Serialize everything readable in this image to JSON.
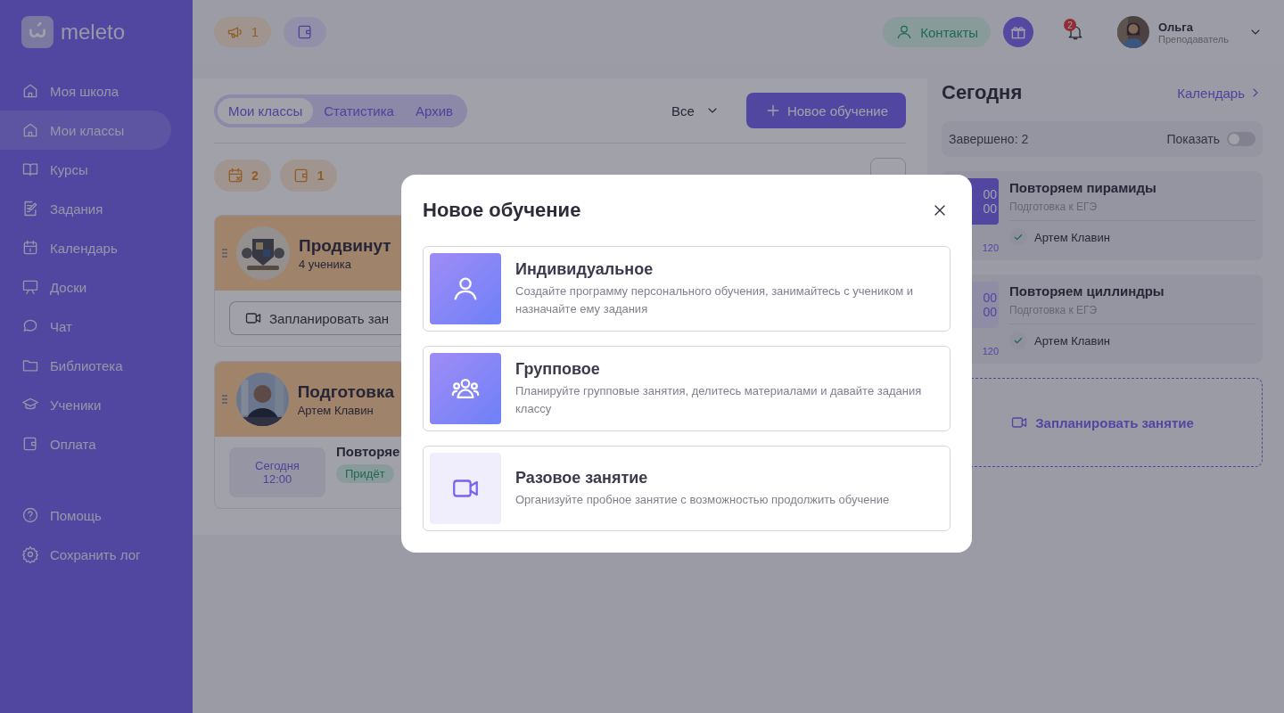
{
  "sidebar": {
    "logo": "meleto",
    "items": [
      {
        "label": "Моя школа",
        "selected": false
      },
      {
        "label": "Мои классы",
        "selected": true
      },
      {
        "label": "Курсы",
        "selected": false
      },
      {
        "label": "Задания",
        "selected": false
      },
      {
        "label": "Календарь",
        "selected": false
      },
      {
        "label": "Доски",
        "selected": false
      },
      {
        "label": "Чат",
        "selected": false
      },
      {
        "label": "Библиотека",
        "selected": false
      },
      {
        "label": "Ученики",
        "selected": false
      },
      {
        "label": "Оплата",
        "selected": false
      }
    ],
    "bottom_items": [
      {
        "label": "Помощь",
        "selected": false
      },
      {
        "label": "Сохранить лог",
        "selected": false
      }
    ]
  },
  "topbar": {
    "announcements": "1",
    "contacts": "Контакты",
    "notifications": "2",
    "user": {
      "name": "Ольга",
      "role": "Преподаватель"
    }
  },
  "classes": {
    "tabs": [
      {
        "label": "Мои классы",
        "selected": true
      },
      {
        "label": "Статистика",
        "selected": false
      },
      {
        "label": "Архив",
        "selected": false
      }
    ],
    "filter": "Все",
    "new_button": "Новое обучение",
    "badges": [
      {
        "kind": "calendar",
        "count": "2"
      },
      {
        "kind": "wallet",
        "count": "1"
      }
    ],
    "cards": [
      {
        "kind": "group",
        "title": "Продвинут",
        "subtitle": "4 ученика",
        "action": "Запланировать зан"
      },
      {
        "kind": "individual",
        "title": "Подготовка",
        "subtitle": "Артем Клавин",
        "lesson": {
          "day": "Сегодня",
          "time": "12:00",
          "title": "Повторяе",
          "status": "Придёт"
        }
      }
    ]
  },
  "today": {
    "title": "Сегодня",
    "calendar_link": "Календарь",
    "completed": "Завершено: 2",
    "show_label": "Показать",
    "show_on": false,
    "lessons": [
      {
        "start": "00",
        "end": "00",
        "count": "120",
        "highlighted": true,
        "title": "Повторяем пирамиды",
        "course": "Подготовка к ЕГЭ",
        "student": "Артем Клавин",
        "confirmed": true
      },
      {
        "start": "00",
        "end": "00",
        "count": "120",
        "highlighted": false,
        "title": "Повторяем циллиндры",
        "course": "Подготовка к ЕГЭ",
        "student": "Артем Клавин",
        "confirmed": true
      }
    ],
    "schedule_button": "Запланировать занятие"
  },
  "modal": {
    "title": "Новое обучение",
    "options": [
      {
        "kind": "individual",
        "title": "Индивидуальное",
        "description": "Создайте программу персонального обучения, занимайтесь с учеником и назначайте ему задания"
      },
      {
        "kind": "group",
        "title": "Групповое",
        "description": "Планируйте групповые занятия, делитесь материалами и давайте задания классу"
      },
      {
        "kind": "single",
        "title": "Разовое занятие",
        "description": "Организуйте пробное занятие с возможностью продолжить обучение"
      }
    ]
  }
}
